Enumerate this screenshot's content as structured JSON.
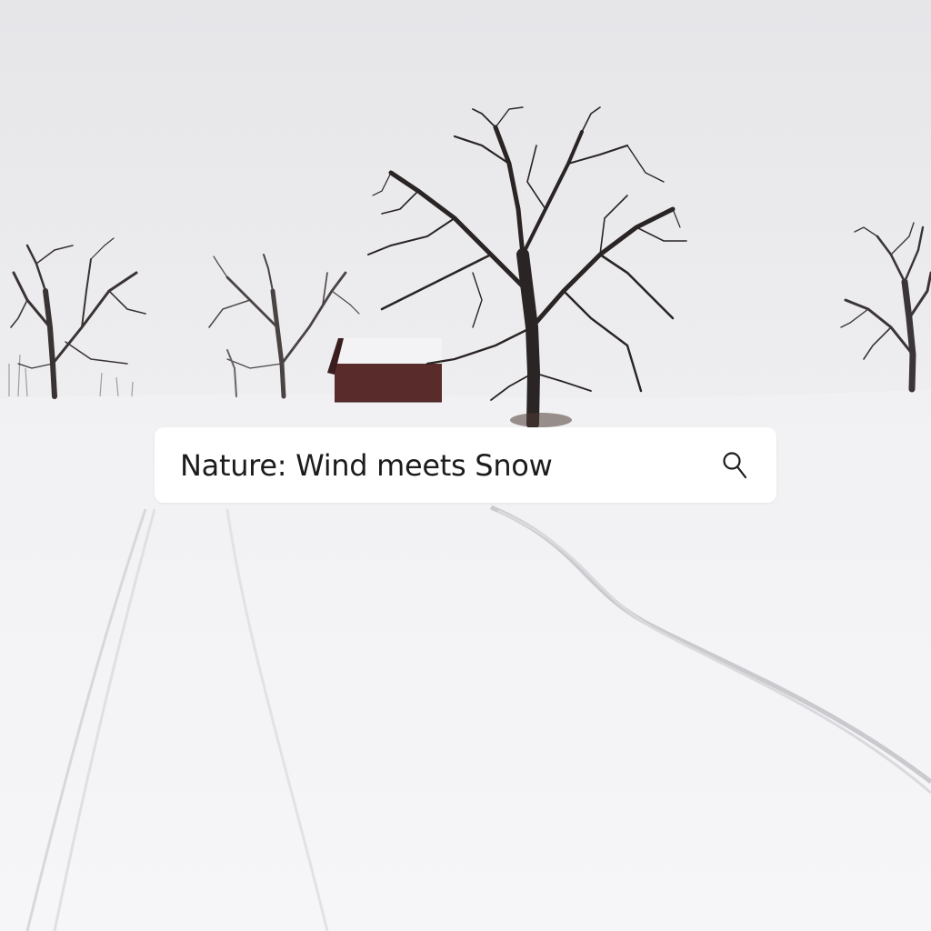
{
  "search": {
    "value": "Nature: Wind meets Snow"
  },
  "icons": {
    "search_button": "search-icon"
  },
  "colors": {
    "sky": "#ebebed",
    "snow": "#f4f4f6",
    "bar_background": "#ffffff",
    "text": "#1c1c1c",
    "cabin": "#5a2b2b",
    "trees": "#2a2424"
  }
}
